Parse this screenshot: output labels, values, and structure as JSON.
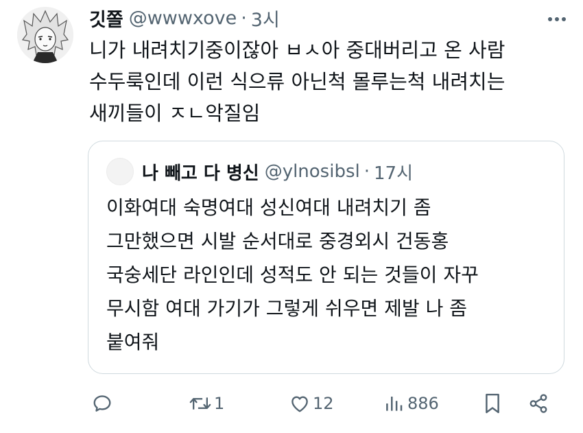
{
  "author": {
    "display_name": "깃쫄",
    "handle": "@wwwxove",
    "separator": "·",
    "time": "3시"
  },
  "tweet_lines": [
    "니가 내려치기중이잖아 ㅂㅅ아 중대버리고 온 사람",
    "수두룩인데 이런 식으류 아닌척 몰루는척 내려치는",
    "새끼들이 ㅈㄴ악질임"
  ],
  "quoted": {
    "display_name": "나 빼고 다 병신",
    "handle": "@ylnosibsl",
    "separator": "·",
    "time": "17시",
    "lines": [
      "이화여대 숙명여대 성신여대 내려치기 좀",
      "그만했으면 시발 순서대로 중경외시 건동홍",
      "국숭세단 라인인데 성적도 안 되는 것들이 자꾸",
      "무시함 여대 가기가 그렇게 쉬우면 제발 나 좀",
      "붙여줘"
    ]
  },
  "actions": {
    "reply": {
      "icon": "reply-icon",
      "count": ""
    },
    "retweet": {
      "icon": "retweet-icon",
      "count": "1"
    },
    "like": {
      "icon": "heart-icon",
      "count": "12"
    },
    "views": {
      "icon": "views-icon",
      "count": "886"
    },
    "bookmark": {
      "icon": "bookmark-icon"
    },
    "share": {
      "icon": "share-icon"
    }
  },
  "colors": {
    "text": "#0f1419",
    "secondary": "#536471",
    "border": "#cfd9de"
  }
}
